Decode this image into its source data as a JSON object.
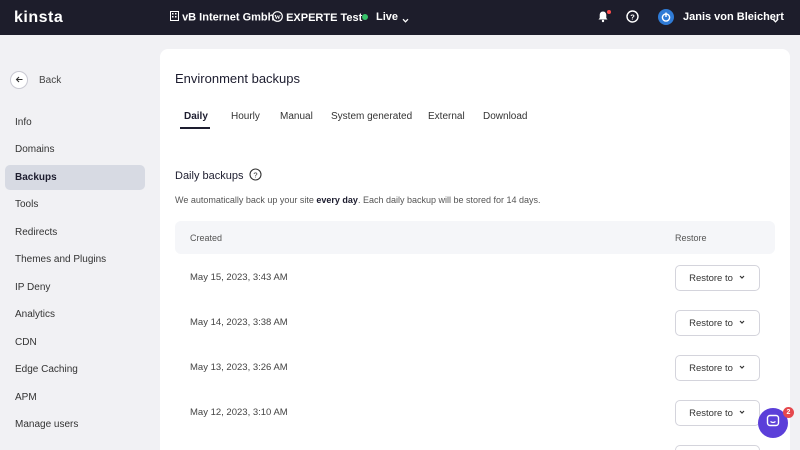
{
  "topbar": {
    "logo": "kinsta",
    "company": "vB Internet Gmbh",
    "site": "EXPERTE Test",
    "environment": "Live",
    "username": "Janis von Bleichert"
  },
  "sidebar": {
    "back_label": "Back",
    "items": [
      {
        "label": "Info"
      },
      {
        "label": "Domains"
      },
      {
        "label": "Backups"
      },
      {
        "label": "Tools"
      },
      {
        "label": "Redirects"
      },
      {
        "label": "Themes and Plugins"
      },
      {
        "label": "IP Deny"
      },
      {
        "label": "Analytics"
      },
      {
        "label": "CDN"
      },
      {
        "label": "Edge Caching"
      },
      {
        "label": "APM"
      },
      {
        "label": "Manage users"
      }
    ],
    "active": "Backups"
  },
  "main": {
    "title": "Environment backups",
    "tabs": [
      {
        "label": "Daily"
      },
      {
        "label": "Hourly"
      },
      {
        "label": "Manual"
      },
      {
        "label": "System generated"
      },
      {
        "label": "External"
      },
      {
        "label": "Download"
      }
    ],
    "active_tab": "Daily",
    "section_title": "Daily backups",
    "desc_before": "We automatically back up your site ",
    "desc_bold": "every day",
    "desc_after": ". Each daily backup will be stored for 14 days.",
    "table": {
      "headers": {
        "created": "Created",
        "restore": "Restore"
      },
      "rows": [
        {
          "created": "May 15, 2023, 3:43 AM",
          "action": "Restore to"
        },
        {
          "created": "May 14, 2023, 3:38 AM",
          "action": "Restore to"
        },
        {
          "created": "May 13, 2023, 3:26 AM",
          "action": "Restore to"
        },
        {
          "created": "May 12, 2023, 3:10 AM",
          "action": "Restore to"
        }
      ]
    }
  },
  "chat": {
    "badge_count": "2"
  },
  "colors": {
    "topbar": "#1d1d2b",
    "live_dot": "#37c26a",
    "notification_dot": "#ff4c4c",
    "chat": "#5b3fd9",
    "active_sidebar": "#d7dae3"
  }
}
